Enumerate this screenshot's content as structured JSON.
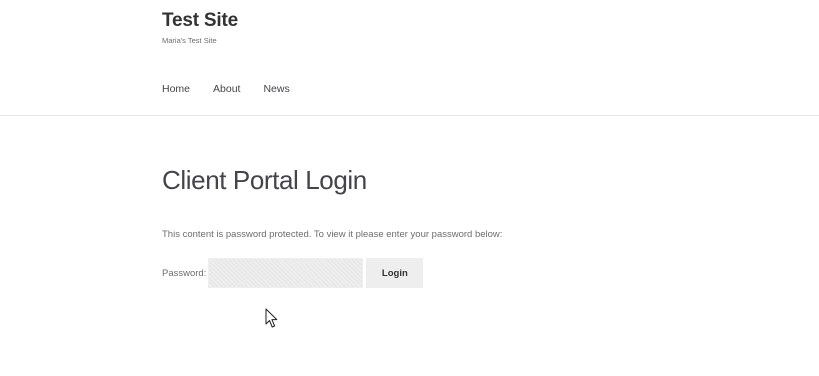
{
  "site": {
    "title": "Test Site",
    "description": "Maria's Test Site"
  },
  "nav": {
    "items": [
      {
        "label": "Home"
      },
      {
        "label": "About"
      },
      {
        "label": "News"
      }
    ]
  },
  "page": {
    "title": "Client Portal Login",
    "protected_message": "This content is password protected. To view it please enter your password below:"
  },
  "form": {
    "password_label": "Password:",
    "password_value": "",
    "submit_label": "Login"
  },
  "icons": {
    "cursor": "mouse-pointer-icon"
  },
  "colors": {
    "text": "#43454b",
    "muted": "#6d6d6d",
    "button_bg": "#eeeeee",
    "header_border": "#e8e8e8"
  }
}
